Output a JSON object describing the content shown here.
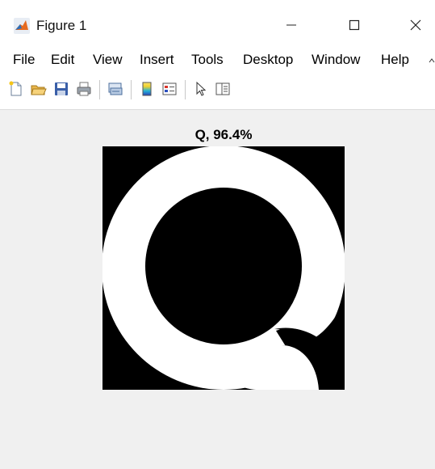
{
  "window": {
    "title": "Figure 1",
    "minimize_label": "—",
    "maximize_label": "☐",
    "close_label": "✕"
  },
  "menu": {
    "items": [
      "File",
      "Edit",
      "View",
      "Insert",
      "Tools",
      "Desktop",
      "Window",
      "Help"
    ]
  },
  "toolbar": {
    "buttons": [
      "new-figure-icon",
      "open-file-icon",
      "save-figure-icon",
      "print-figure-icon",
      "link-plot-icon",
      "insert-colorbar-icon",
      "insert-legend-icon",
      "edit-plot-arrow-icon",
      "property-inspector-icon"
    ]
  },
  "axes": {
    "title": "Q, 96.4%",
    "image_content": "Q"
  },
  "colors": {
    "image_background": "#000000",
    "glyph": "#ffffff",
    "window_background": "#f0f0f0"
  }
}
